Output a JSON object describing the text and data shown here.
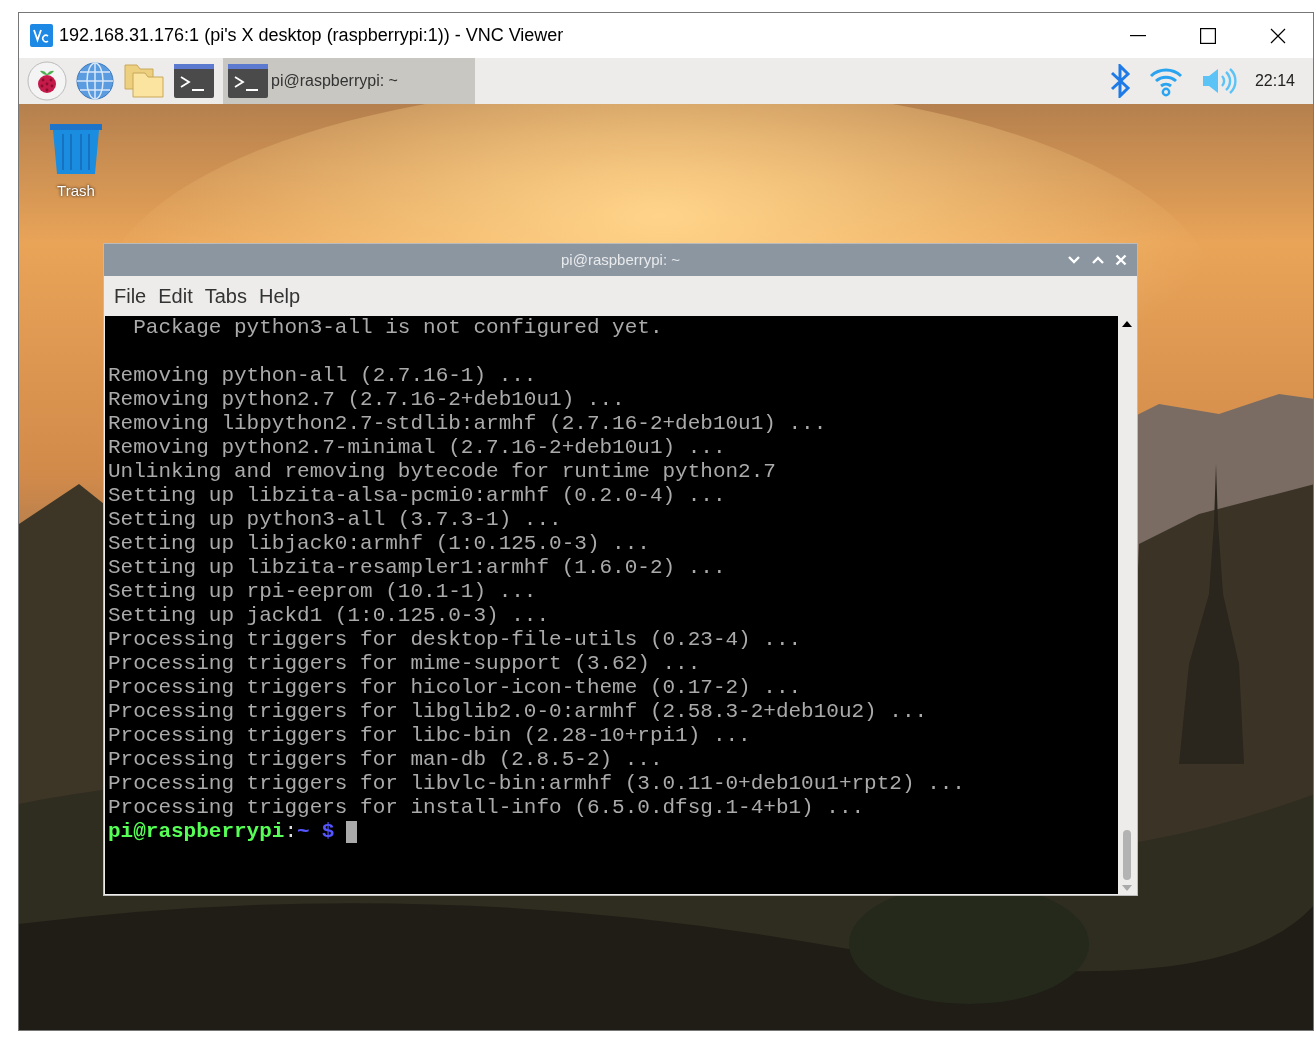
{
  "window": {
    "title": "192.168.31.176:1 (pi's X desktop (raspberrypi:1)) - VNC Viewer"
  },
  "panel": {
    "launchers": [
      {
        "kind": "menu"
      },
      {
        "kind": "browser"
      },
      {
        "kind": "files"
      },
      {
        "kind": "terminal"
      }
    ],
    "tasks": [
      {
        "label": "pi@raspberrypi: ~",
        "selected": true
      }
    ],
    "clock": "22:14"
  },
  "desktop": {
    "icons": [
      {
        "label": "Trash"
      }
    ]
  },
  "terminal": {
    "title": "pi@raspberrypi: ~",
    "menu": [
      "File",
      "Edit",
      "Tabs",
      "Help"
    ],
    "lines": [
      {
        "kind": "text",
        "text": "  Package python3-all is not configured yet."
      },
      {
        "kind": "blank"
      },
      {
        "kind": "text",
        "text": "Removing python-all (2.7.16-1) ..."
      },
      {
        "kind": "text",
        "text": "Removing python2.7 (2.7.16-2+deb10u1) ..."
      },
      {
        "kind": "text",
        "text": "Removing libpython2.7-stdlib:armhf (2.7.16-2+deb10u1) ..."
      },
      {
        "kind": "text",
        "text": "Removing python2.7-minimal (2.7.16-2+deb10u1) ..."
      },
      {
        "kind": "text",
        "text": "Unlinking and removing bytecode for runtime python2.7"
      },
      {
        "kind": "text",
        "text": "Setting up libzita-alsa-pcmi0:armhf (0.2.0-4) ..."
      },
      {
        "kind": "text",
        "text": "Setting up python3-all (3.7.3-1) ..."
      },
      {
        "kind": "text",
        "text": "Setting up libjack0:armhf (1:0.125.0-3) ..."
      },
      {
        "kind": "text",
        "text": "Setting up libzita-resampler1:armhf (1.6.0-2) ..."
      },
      {
        "kind": "text",
        "text": "Setting up rpi-eeprom (10.1-1) ..."
      },
      {
        "kind": "text",
        "text": "Setting up jackd1 (1:0.125.0-3) ..."
      },
      {
        "kind": "text",
        "text": "Processing triggers for desktop-file-utils (0.23-4) ..."
      },
      {
        "kind": "text",
        "text": "Processing triggers for mime-support (3.62) ..."
      },
      {
        "kind": "text",
        "text": "Processing triggers for hicolor-icon-theme (0.17-2) ..."
      },
      {
        "kind": "text",
        "text": "Processing triggers for libglib2.0-0:armhf (2.58.3-2+deb10u2) ..."
      },
      {
        "kind": "text",
        "text": "Processing triggers for libc-bin (2.28-10+rpi1) ..."
      },
      {
        "kind": "text",
        "text": "Processing triggers for man-db (2.8.5-2) ..."
      },
      {
        "kind": "text",
        "text": "Processing triggers for libvlc-bin:armhf (3.0.11-0+deb10u1+rpt2) ..."
      },
      {
        "kind": "text",
        "text": "Processing triggers for install-info (6.5.0.dfsg.1-4+b1) ..."
      }
    ],
    "prompt": {
      "user_host": "pi@raspberrypi",
      "separator": ":",
      "path": "~",
      "symbol": "$"
    }
  }
}
